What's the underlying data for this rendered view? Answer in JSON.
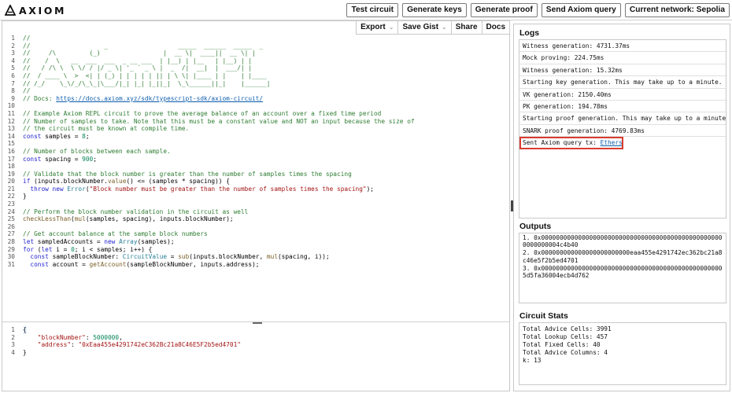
{
  "app": {
    "logo_text": "AXIOM",
    "top_buttons": [
      "Test circuit",
      "Generate keys",
      "Generate proof",
      "Send Axiom query",
      "Current network: Sepolia"
    ]
  },
  "editor": {
    "toolbar": {
      "export": "Export",
      "save_gist": "Save Gist",
      "share": "Share",
      "docs": "Docs"
    },
    "lines": [
      [
        [
          "com",
          "//"
        ]
      ],
      [
        [
          "com",
          "//                    _                   _____  ______  _____  _"
        ]
      ],
      [
        [
          "com",
          "//     /\\         (_)                 |  __ \\|  ____||  __ \\| |"
        ]
      ],
      [
        [
          "com",
          "//    /  \\   __  ___  ___  _ __ ___  | |__) | |__   | |__) | |"
        ]
      ],
      [
        [
          "com",
          "//   / /\\ \\  \\ \\/ / |/ _ \\| '_ ` _ \\ |  _  /|  __|  |  ___/| |"
        ]
      ],
      [
        [
          "com",
          "//  / ____ \\  >  <| | (_) | | | | | || | \\ \\| |____ | |    | |____"
        ]
      ],
      [
        [
          "com",
          "// /_/    \\_\\/_/\\_\\_|\\___/|_| |_| |_||_|  \\_\\______||_|    |______|"
        ]
      ],
      [
        [
          "com",
          "//"
        ]
      ],
      [
        [
          "com",
          "// Docs: "
        ],
        [
          "link",
          "https://docs.axiom.xyz/sdk/typescript-sdk/axiom-circuit/"
        ]
      ],
      [],
      [
        [
          "com",
          "// Example Axiom REPL circuit to prove the average balance of an account over a fixed time period"
        ]
      ],
      [
        [
          "com",
          "// Number of samples to take. Note that this must be a constant value and NOT an input because the size of"
        ]
      ],
      [
        [
          "com",
          "// the circuit must be known at compile time."
        ]
      ],
      [
        [
          "kw",
          "const"
        ],
        [
          "txt",
          " samples = "
        ],
        [
          "num",
          "8"
        ],
        [
          "txt",
          ";"
        ]
      ],
      [],
      [
        [
          "com",
          "// Number of blocks between each sample."
        ]
      ],
      [
        [
          "kw",
          "const"
        ],
        [
          "txt",
          " spacing = "
        ],
        [
          "num",
          "900"
        ],
        [
          "txt",
          ";"
        ]
      ],
      [],
      [
        [
          "com",
          "// Validate that the block number is greater than the number of samples times the spacing"
        ]
      ],
      [
        [
          "kw",
          "if"
        ],
        [
          "txt",
          " (inputs.blockNumber."
        ],
        [
          "fn",
          "value"
        ],
        [
          "txt",
          "() <= (samples * spacing)) {"
        ]
      ],
      [
        [
          "txt",
          "  "
        ],
        [
          "kw",
          "throw new"
        ],
        [
          "txt",
          " "
        ],
        [
          "type",
          "Error"
        ],
        [
          "txt",
          "("
        ],
        [
          "str",
          "\"Block number must be greater than the number of samples times the spacing\""
        ],
        [
          "txt",
          ");"
        ]
      ],
      [
        [
          "txt",
          "}"
        ]
      ],
      [],
      [
        [
          "com",
          "// Perform the block number validation in the circuit as well"
        ]
      ],
      [
        [
          "fn",
          "checkLessThan"
        ],
        [
          "txt",
          "("
        ],
        [
          "fn",
          "mul"
        ],
        [
          "txt",
          "(samples, spacing), inputs.blockNumber);"
        ]
      ],
      [],
      [
        [
          "com",
          "// Get account balance at the sample block numbers"
        ]
      ],
      [
        [
          "kw",
          "let"
        ],
        [
          "txt",
          " sampledAccounts = "
        ],
        [
          "kw",
          "new"
        ],
        [
          "txt",
          " "
        ],
        [
          "type",
          "Array"
        ],
        [
          "txt",
          "(samples);"
        ]
      ],
      [
        [
          "kw",
          "for"
        ],
        [
          "txt",
          " ("
        ],
        [
          "kw",
          "let"
        ],
        [
          "txt",
          " i = "
        ],
        [
          "num",
          "0"
        ],
        [
          "txt",
          "; i < samples; i++) {"
        ]
      ],
      [
        [
          "txt",
          "  "
        ],
        [
          "kw",
          "const"
        ],
        [
          "txt",
          " sampleBlockNumber: "
        ],
        [
          "type",
          "CircuitValue"
        ],
        [
          "txt",
          " = "
        ],
        [
          "fn",
          "sub"
        ],
        [
          "txt",
          "(inputs.blockNumber, "
        ],
        [
          "fn",
          "mul"
        ],
        [
          "txt",
          "(spacing, i));"
        ]
      ],
      [
        [
          "txt",
          "  "
        ],
        [
          "kw",
          "const"
        ],
        [
          "txt",
          " account = "
        ],
        [
          "fn",
          "getAccount"
        ],
        [
          "txt",
          "(sampleBlockNumber, inputs.address);"
        ]
      ]
    ],
    "inputs_lines": [
      [
        [
          "txt",
          "{"
        ]
      ],
      [
        [
          "txt",
          "    "
        ],
        [
          "str",
          "\"blockNumber\""
        ],
        [
          "txt",
          ": "
        ],
        [
          "num",
          "5000000"
        ],
        [
          "txt",
          ","
        ]
      ],
      [
        [
          "txt",
          "    "
        ],
        [
          "str",
          "\"address\""
        ],
        [
          "txt",
          ": "
        ],
        [
          "str",
          "\"0xEaa455e4291742eC362Bc21a8C46E5F2b5ed4701\""
        ]
      ],
      [
        [
          "txt",
          "}"
        ]
      ]
    ]
  },
  "logs": {
    "title": "Logs",
    "rows": [
      "Witness generation: 4731.37ms",
      "Mock proving: 224.75ms",
      "Witness generation: 15.32ms",
      "Starting key generation. This may take up to a minute.",
      "VK generation: 2150.40ms",
      "PK generation: 194.78ms",
      "Starting proof generation. This may take up to a minute.",
      "SNARK proof generation: 4769.83ms"
    ],
    "last_prefix": "Sent Axiom query tx: ",
    "last_link": "Etherscan"
  },
  "outputs": {
    "title": "Outputs",
    "rows": [
      "1. 0x00000000000000000000000000000000000000000000000000000000004c4b40",
      "2. 0x000000000000000000000000eaa455e4291742ec362bc21a8c46e5f2b5ed4701",
      "3. 0x00000000000000000000000000000000000000000000000005d5fa36004ecb4d762"
    ]
  },
  "stats": {
    "title": "Circuit Stats",
    "rows": [
      "Total Advice Cells: 3991",
      "Total Lookup Cells: 457",
      "Total Fixed Cells: 40",
      "Total Advice Columns: 4",
      "k: 13"
    ]
  }
}
